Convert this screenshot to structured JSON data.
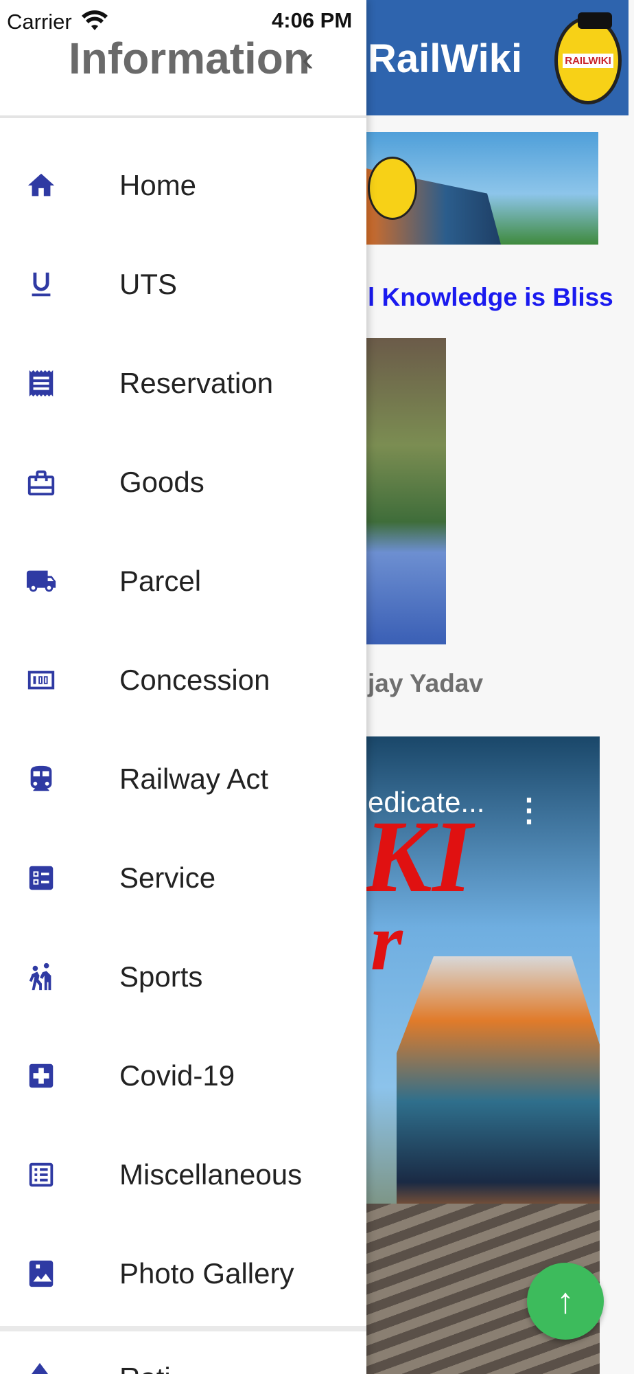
{
  "status_bar": {
    "carrier": "Carrier",
    "time": "4:06 PM"
  },
  "app": {
    "title": "RailWiki",
    "logo_text": "RAILWIKI",
    "tagline": "l Knowledge is Bliss",
    "person_name": "jay Yadav",
    "video_title": "edicate...",
    "video_overlay_1": "KI",
    "video_overlay_2": "r",
    "colors": {
      "app_bar": "#2e64ae",
      "tagline": "#1a1aef",
      "fab": "#3dbb5c"
    }
  },
  "drawer": {
    "title": "Information",
    "back_icon": "chevron-left-icon",
    "items": [
      {
        "label": "Home",
        "icon": "home-icon"
      },
      {
        "label": "UTS",
        "icon": "underline-u-icon"
      },
      {
        "label": "Reservation",
        "icon": "receipt-icon"
      },
      {
        "label": "Goods",
        "icon": "briefcase-icon"
      },
      {
        "label": "Parcel",
        "icon": "truck-icon"
      },
      {
        "label": "Concession",
        "icon": "counter-100-icon"
      },
      {
        "label": "Railway Act",
        "icon": "train-icon"
      },
      {
        "label": "Service",
        "icon": "checklist-icon"
      },
      {
        "label": "Sports",
        "icon": "sports-icon"
      },
      {
        "label": "Covid-19",
        "icon": "medical-plus-icon"
      },
      {
        "label": "Miscellaneous",
        "icon": "list-icon"
      },
      {
        "label": "Photo Gallery",
        "icon": "photo-icon"
      }
    ],
    "partial_item_label": "Rati",
    "icon_color": "#2f3aa3"
  }
}
